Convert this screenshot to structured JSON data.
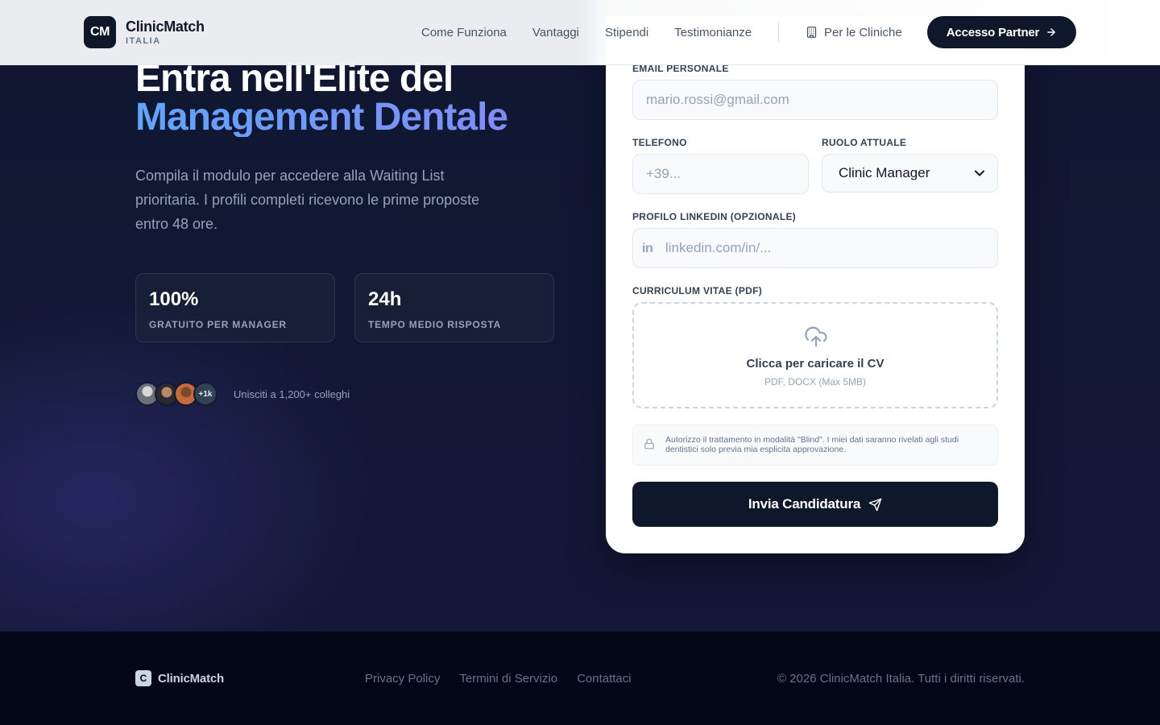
{
  "brand": {
    "logo": "CM",
    "name": "ClinicMatch",
    "subtitle": "ITALIA"
  },
  "nav": {
    "links": [
      "Come Funziona",
      "Vantaggi",
      "Stipendi",
      "Testimonianze"
    ],
    "clinics": {
      "label": "Per le Cliniche",
      "icon": "building-icon"
    },
    "partner_button": "Accesso Partner"
  },
  "hero": {
    "title_line1": "Entra nell'Elite del",
    "title_line2": "Management Dentale",
    "description": "Compila il modulo per accedere alla Waiting List prioritaria. I profili completi ricevono le prime proposte entro 48 ore.",
    "stats": [
      {
        "value": "100%",
        "label": "GRATUITO PER MANAGER"
      },
      {
        "value": "24h",
        "label": "TEMPO MEDIO RISPOSTA"
      }
    ],
    "social": {
      "more": "+1k",
      "text": "Unisciti a 1,200+ colleghi"
    }
  },
  "form": {
    "email": {
      "label": "EMAIL PERSONALE",
      "placeholder": "mario.rossi@gmail.com"
    },
    "phone": {
      "label": "TELEFONO",
      "placeholder": "+39..."
    },
    "role": {
      "label": "RUOLO ATTUALE",
      "value": "Clinic Manager"
    },
    "linkedin": {
      "label": "PROFILO LINKEDIN (OPZIONALE)",
      "placeholder": "linkedin.com/in/...",
      "icon_text": "in"
    },
    "cv": {
      "label": "CURRICULUM VITAE (PDF)",
      "title": "Clicca per caricare il CV",
      "subtitle": "PDF, DOCX (Max 5MB)"
    },
    "consent": "Autorizzo il trattamento in modalità \"Blind\". I miei dati saranno rivelati agli studi dentistici solo previa mia esplicita approvazione.",
    "submit": "Invia Candidatura"
  },
  "footer": {
    "logo": "C",
    "name": "ClinicMatch",
    "links": [
      "Privacy Policy",
      "Termini di Servizio",
      "Contattaci"
    ],
    "copyright": "© 2026 ClinicMatch Italia. Tutti i diritti riservati."
  },
  "colors": {
    "primary_dark": "#0f172a",
    "accent_blue": "#60a5fa",
    "accent_indigo": "#818cf8"
  }
}
